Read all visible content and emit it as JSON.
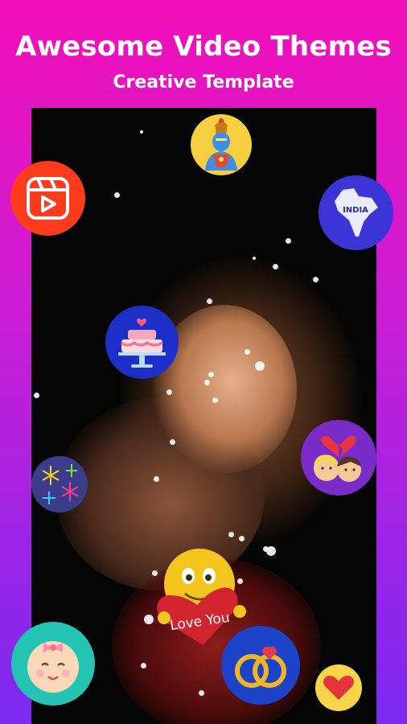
{
  "header": {
    "title": "Awesome Video Themes",
    "subtitle": "Creative Template"
  },
  "badges": {
    "india_label": "INDIA",
    "love_label": "Love You"
  },
  "icons": [
    "god-avatar-icon",
    "video-reels-icon",
    "india-map-icon",
    "birthday-cake-icon",
    "broken-heart-couple-icon",
    "fireworks-icon",
    "love-you-emoji-icon",
    "baby-face-icon",
    "wedding-rings-icon",
    "heart-icon"
  ],
  "colors": {
    "gradient_top": "#f20fb8",
    "gradient_bottom": "#7a2af2",
    "frame": "#050505",
    "reels_red": "#ff3b1e",
    "india_blue": "#3b35d8",
    "cake_blue": "#1e2ec9",
    "couple_purple": "#7b2bc8",
    "rings_blue": "#1d44c8",
    "baby_teal": "#23c4b4",
    "heart_yellow": "#f9d34a"
  }
}
